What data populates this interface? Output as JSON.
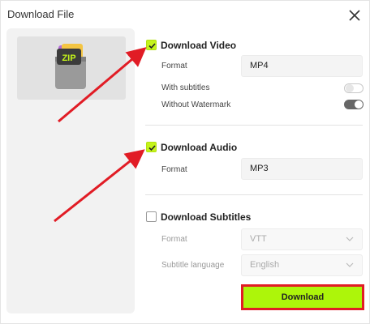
{
  "dialog": {
    "title": "Download File"
  },
  "thumbnail": {
    "icon": "zip-archive-icon",
    "label": "ZIP"
  },
  "video": {
    "checked": true,
    "title": "Download Video",
    "format_label": "Format",
    "format_value": "MP4",
    "subtitles_label": "With subtitles",
    "subtitles_on": false,
    "watermark_label": "Without Watermark",
    "watermark_on": true
  },
  "audio": {
    "checked": true,
    "title": "Download Audio",
    "format_label": "Format",
    "format_value": "MP3"
  },
  "subtitles": {
    "checked": false,
    "title": "Download Subtitles",
    "format_label": "Format",
    "format_value": "VTT",
    "language_label": "Subtitle language",
    "language_value": "English"
  },
  "actions": {
    "download_label": "Download"
  },
  "colors": {
    "accent": "#adf50a",
    "highlight": "#e11c25"
  }
}
